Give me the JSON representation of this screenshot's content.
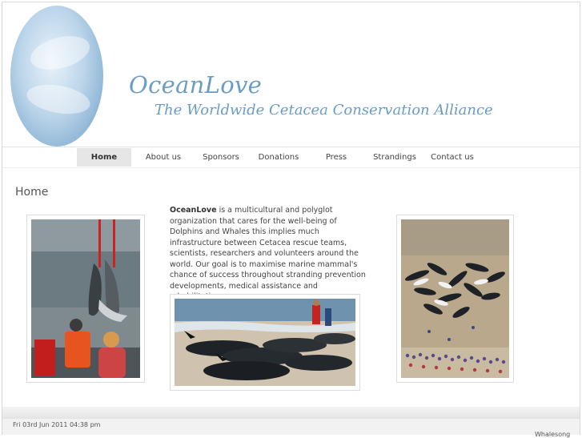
{
  "brand": {
    "title": "OceanLove",
    "subtitle": "The Worldwide Cetacea Conservation Alliance"
  },
  "nav": [
    {
      "label": "Home",
      "active": true
    },
    {
      "label": "About us",
      "active": false
    },
    {
      "label": "Sponsors",
      "active": false
    },
    {
      "label": "Donations",
      "active": false
    },
    {
      "label": "Press",
      "active": false
    },
    {
      "label": "Strandings",
      "active": false
    },
    {
      "label": "Contact us",
      "active": false
    }
  ],
  "page": {
    "title": "Home",
    "intro_bold": "OceanLove",
    "intro_text": " is a multicultural and polyglot organization that cares for the well-being of Dolphins and Whales this implies much infrastructure between Cetacea rescue teams, scientists, researchers and volunteers around the world. Our goal is to maximise marine mammal's chance of success throughout stranding prevention developments, medical assistance and rehabilitation."
  },
  "footer": {
    "date": "Fri 03rd Jun 2011 04:38 pm",
    "right_text": "Whalesong"
  },
  "colors": {
    "brand_blue": "#6b9cc4",
    "nav_active_bg": "#e6e6e6"
  }
}
